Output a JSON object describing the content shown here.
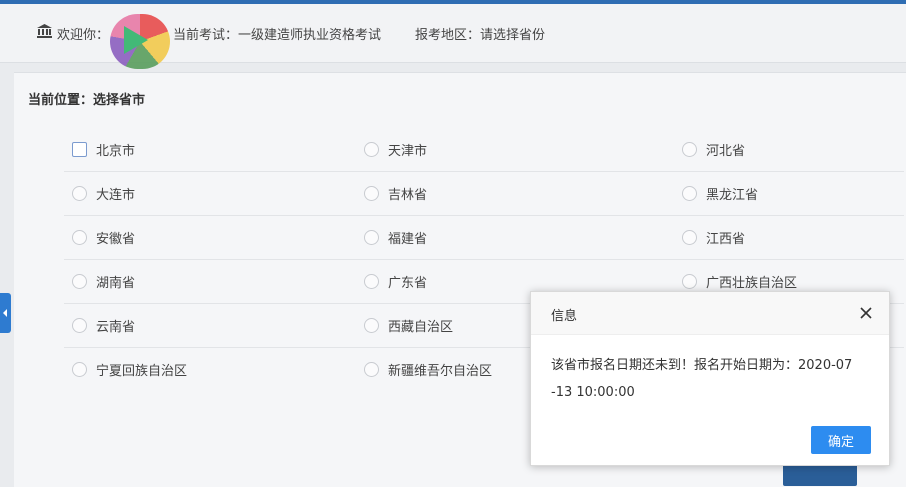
{
  "header": {
    "welcome": "欢迎你：",
    "exam_label": "当前考试：一级建造师执业资格考试",
    "region_label": "报考地区：请选择省份",
    "icon": "bank-icon"
  },
  "breadcrumb": "当前位置：选择省市",
  "provinces": [
    [
      "北京市",
      "天津市",
      "河北省"
    ],
    [
      "大连市",
      "吉林省",
      "黑龙江省"
    ],
    [
      "安徽省",
      "福建省",
      "江西省"
    ],
    [
      "湖南省",
      "广东省",
      "广西壮族自治区"
    ],
    [
      "云南省",
      "西藏自治区",
      ""
    ],
    [
      "宁夏回族自治区",
      "新疆维吾尔自治区",
      ""
    ]
  ],
  "dialog": {
    "title": "信息",
    "message_line1": "该省市报名日期还未到！报名开始日期为：2020-07",
    "message_line2": "-13 10:00:00",
    "ok_label": "确定",
    "close_icon": "close-icon"
  },
  "colors": {
    "accent": "#2d8cf0",
    "topbar": "#2f6db3"
  }
}
